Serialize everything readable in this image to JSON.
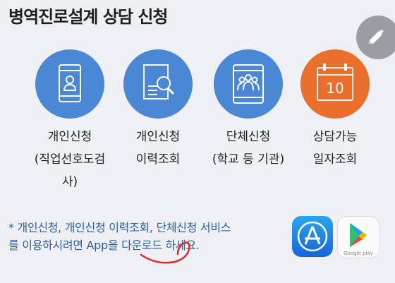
{
  "page": {
    "title": "병역진로설계 상담 신청"
  },
  "icons": {
    "edit": "pencil-icon"
  },
  "options": [
    {
      "id": "individual",
      "icon": "smartphone-person-icon",
      "line1": "개인신청",
      "line2": "(직업선호도검",
      "line3": "사)"
    },
    {
      "id": "history",
      "icon": "document-search-icon",
      "line1": "개인신청",
      "line2": "이력조회"
    },
    {
      "id": "group",
      "icon": "tablet-group-icon",
      "line1": "단체신청",
      "line2": "(학교 등 기관)"
    },
    {
      "id": "availability",
      "icon": "calendar-icon",
      "calendar_day": "10",
      "line1": "상담가능",
      "line2": "일자조회"
    }
  ],
  "note": {
    "line1": "* 개인신청, 개인신청 이력조회, 단체신청 서비스",
    "line2": "를 이용하시려면 App을 다운로드 하세요."
  },
  "stores": {
    "appstore_icon": "app-store-icon",
    "googleplay_icon": "google-play-icon",
    "googleplay_label": "Google play"
  },
  "colors": {
    "blue": "#4a87d4",
    "orange": "#ea6e2c",
    "note": "#2f5fa2",
    "annotation": "#e02a2a"
  }
}
